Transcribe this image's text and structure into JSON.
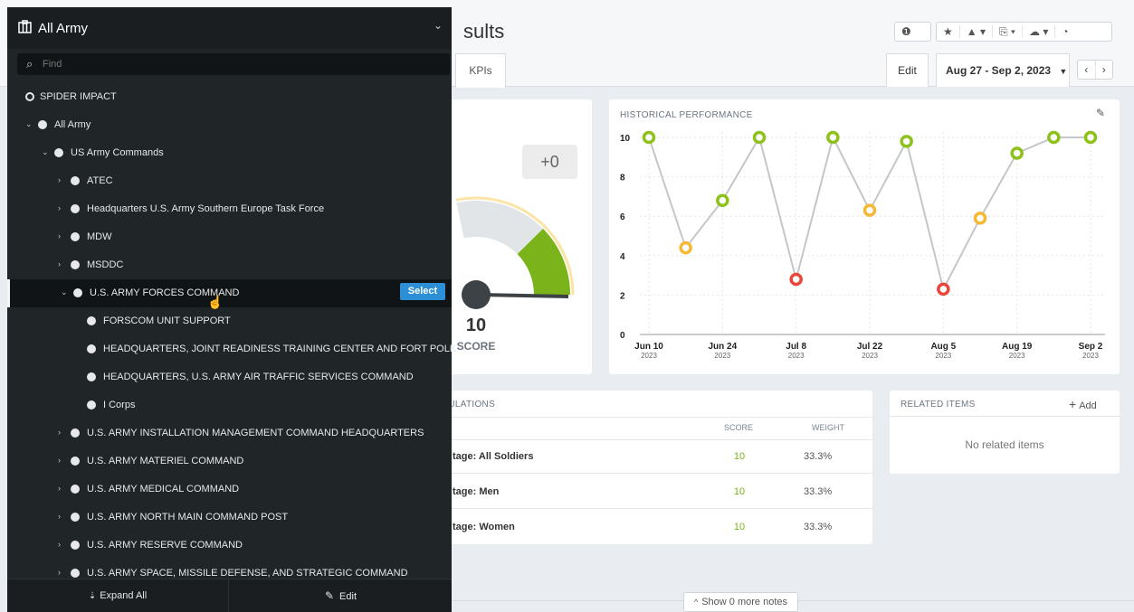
{
  "page": {
    "title": "sults"
  },
  "toolbar": {
    "icons": [
      "info-icon",
      "star-icon",
      "alert-icon",
      "export-icon",
      "cloud-icon",
      "history-icon"
    ],
    "glyphs": [
      "❶",
      "★",
      "▲ ▾",
      "⎘ ▾",
      "☁ ▾",
      "◔"
    ]
  },
  "tabs": {
    "kpis": "KPIs"
  },
  "header_actions": {
    "edit": "Edit",
    "date_range": "Aug 27 - Sep 2, 2023",
    "date_caret": "▼",
    "prev": "‹",
    "next": "›"
  },
  "score_card": {
    "change": "+0",
    "score": "10",
    "score_label": "SCORE",
    "gauge_value": 10,
    "gauge_max": 10
  },
  "historical": {
    "title": "HISTORICAL PERFORMANCE",
    "edit_icon": "pencil-icon"
  },
  "chart_data": {
    "type": "line",
    "title": "HISTORICAL PERFORMANCE",
    "ylim": [
      0,
      10
    ],
    "yticks": [
      "0",
      "2",
      "4",
      "6",
      "8",
      "10"
    ],
    "xtick_labels": [
      {
        "main": "Jun 10",
        "sub": "2023"
      },
      {
        "main": "Jun 24",
        "sub": "2023"
      },
      {
        "main": "Jul 8",
        "sub": "2023"
      },
      {
        "main": "Jul 22",
        "sub": "2023"
      },
      {
        "main": "Aug 5",
        "sub": "2023"
      },
      {
        "main": "Aug 19",
        "sub": "2023"
      },
      {
        "main": "Sep 2",
        "sub": "2023"
      }
    ],
    "x": [
      "Jun 10, 2023",
      "Jun 17, 2023",
      "Jun 24, 2023",
      "Jul 1, 2023",
      "Jul 8, 2023",
      "Jul 15, 2023",
      "Jul 22, 2023",
      "Jul 29, 2023",
      "Aug 5, 2023",
      "Aug 12, 2023",
      "Aug 19, 2023",
      "Aug 26, 2023",
      "Sep 2, 2023"
    ],
    "values": [
      10,
      4.4,
      6.8,
      10,
      2.8,
      10,
      6.3,
      9.8,
      2.3,
      5.9,
      9.2,
      10,
      10
    ],
    "status": [
      "green",
      "yellow",
      "green",
      "green",
      "red",
      "green",
      "yellow",
      "green",
      "red",
      "yellow",
      "green",
      "green",
      "green"
    ],
    "colors": {
      "green": "#8cc21a",
      "yellow": "#f5b935",
      "red": "#e8473a",
      "line": "#c4c7ca",
      "grid": "#e3e6e9"
    }
  },
  "calculations": {
    "title": "LCULATIONS",
    "col_score": "SCORE",
    "col_weight": "WEIGHT",
    "rows": [
      {
        "name": "tage: All Soldiers",
        "score": "10",
        "weight": "33.3%"
      },
      {
        "name": "tage: Men",
        "score": "10",
        "weight": "33.3%"
      },
      {
        "name": "tage: Women",
        "score": "10",
        "weight": "33.3%"
      }
    ]
  },
  "related": {
    "title": "RELATED ITEMS",
    "add": "Add",
    "empty": "No related items"
  },
  "notes": {
    "show_more": "Show 0 more notes"
  },
  "sidebar": {
    "title": "All Army",
    "search_placeholder": "Find",
    "select_label": "Select",
    "items": [
      {
        "label": "SPIDER IMPACT",
        "level": 0,
        "arrow": "",
        "ring": true
      },
      {
        "label": "All Army",
        "level": 0,
        "arrow": "⌄"
      },
      {
        "label": "US Army Commands",
        "level": 1,
        "arrow": "⌄"
      },
      {
        "label": "ATEC",
        "level": 2,
        "arrow": "›"
      },
      {
        "label": "Headquarters U.S. Army Southern Europe Task Force",
        "level": 2,
        "arrow": "›"
      },
      {
        "label": "MDW",
        "level": 2,
        "arrow": "›"
      },
      {
        "label": "MSDDC",
        "level": 2,
        "arrow": "›"
      },
      {
        "label": "U.S. ARMY FORCES COMMAND",
        "level": 2,
        "arrow": "⌄",
        "selected": true
      },
      {
        "label": "FORSCOM UNIT SUPPORT",
        "level": 3,
        "arrow": ""
      },
      {
        "label": "HEADQUARTERS, JOINT READINESS TRAINING CENTER AND FORT POLK",
        "level": 3,
        "arrow": ""
      },
      {
        "label": "HEADQUARTERS, U.S. ARMY AIR TRAFFIC SERVICES COMMAND",
        "level": 3,
        "arrow": ""
      },
      {
        "label": "I Corps",
        "level": 3,
        "arrow": ""
      },
      {
        "label": "U.S. ARMY INSTALLATION MANAGEMENT COMMAND HEADQUARTERS",
        "level": 2,
        "arrow": "›"
      },
      {
        "label": "U.S. ARMY MATERIEL COMMAND",
        "level": 2,
        "arrow": "›"
      },
      {
        "label": "U.S. ARMY MEDICAL COMMAND",
        "level": 2,
        "arrow": "›"
      },
      {
        "label": "U.S. ARMY NORTH MAIN COMMAND POST",
        "level": 2,
        "arrow": "›"
      },
      {
        "label": "U.S. ARMY RESERVE COMMAND",
        "level": 2,
        "arrow": "›"
      },
      {
        "label": "U.S. ARMY SPACE, MISSILE DEFENSE, AND STRATEGIC COMMAND",
        "level": 2,
        "arrow": "›"
      }
    ],
    "footer": {
      "expand_all": "Expand All",
      "edit": "Edit"
    }
  }
}
